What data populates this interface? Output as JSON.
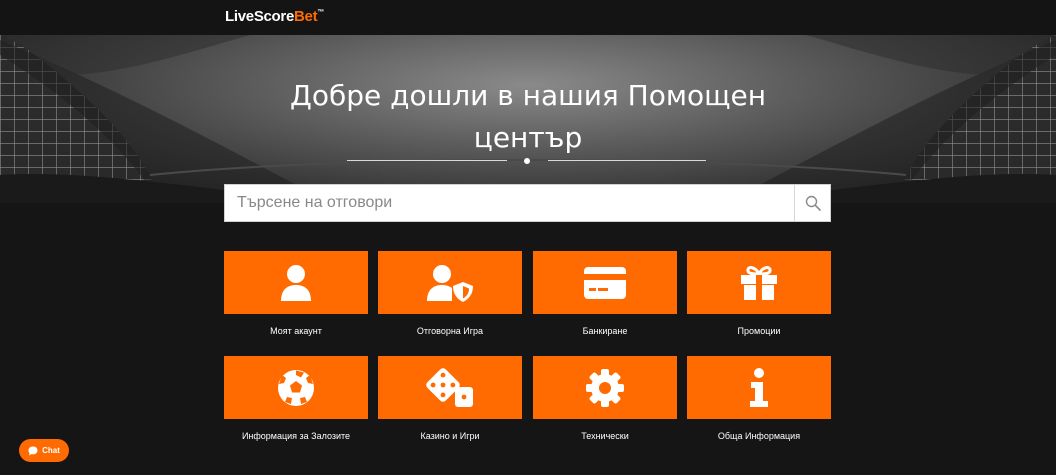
{
  "header": {
    "logo_main": "LiveScore",
    "logo_accent": "Bet",
    "logo_mark": "™"
  },
  "hero": {
    "title_line1": "Добре дошли в нашия Помощен",
    "title_line2": "център"
  },
  "search": {
    "placeholder": "Търсене на отговори",
    "icon": "search-icon"
  },
  "categories": [
    {
      "label": "Моят акаунт",
      "icon": "user-icon"
    },
    {
      "label": "Отговорна Игра",
      "icon": "user-shield-icon"
    },
    {
      "label": "Банкиране",
      "icon": "credit-card-icon"
    },
    {
      "label": "Промоции",
      "icon": "gift-icon"
    },
    {
      "label": "Информация за Залозите",
      "icon": "football-icon"
    },
    {
      "label": "Казино и Игри",
      "icon": "dice-icon"
    },
    {
      "label": "Технически",
      "icon": "gear-icon"
    },
    {
      "label": "Обща Информация",
      "icon": "info-icon"
    }
  ],
  "chat": {
    "label": "Chat",
    "icon": "chat-bubble-icon"
  },
  "colors": {
    "accent": "#ff6b00",
    "background": "#151515",
    "text": "#ffffff"
  }
}
